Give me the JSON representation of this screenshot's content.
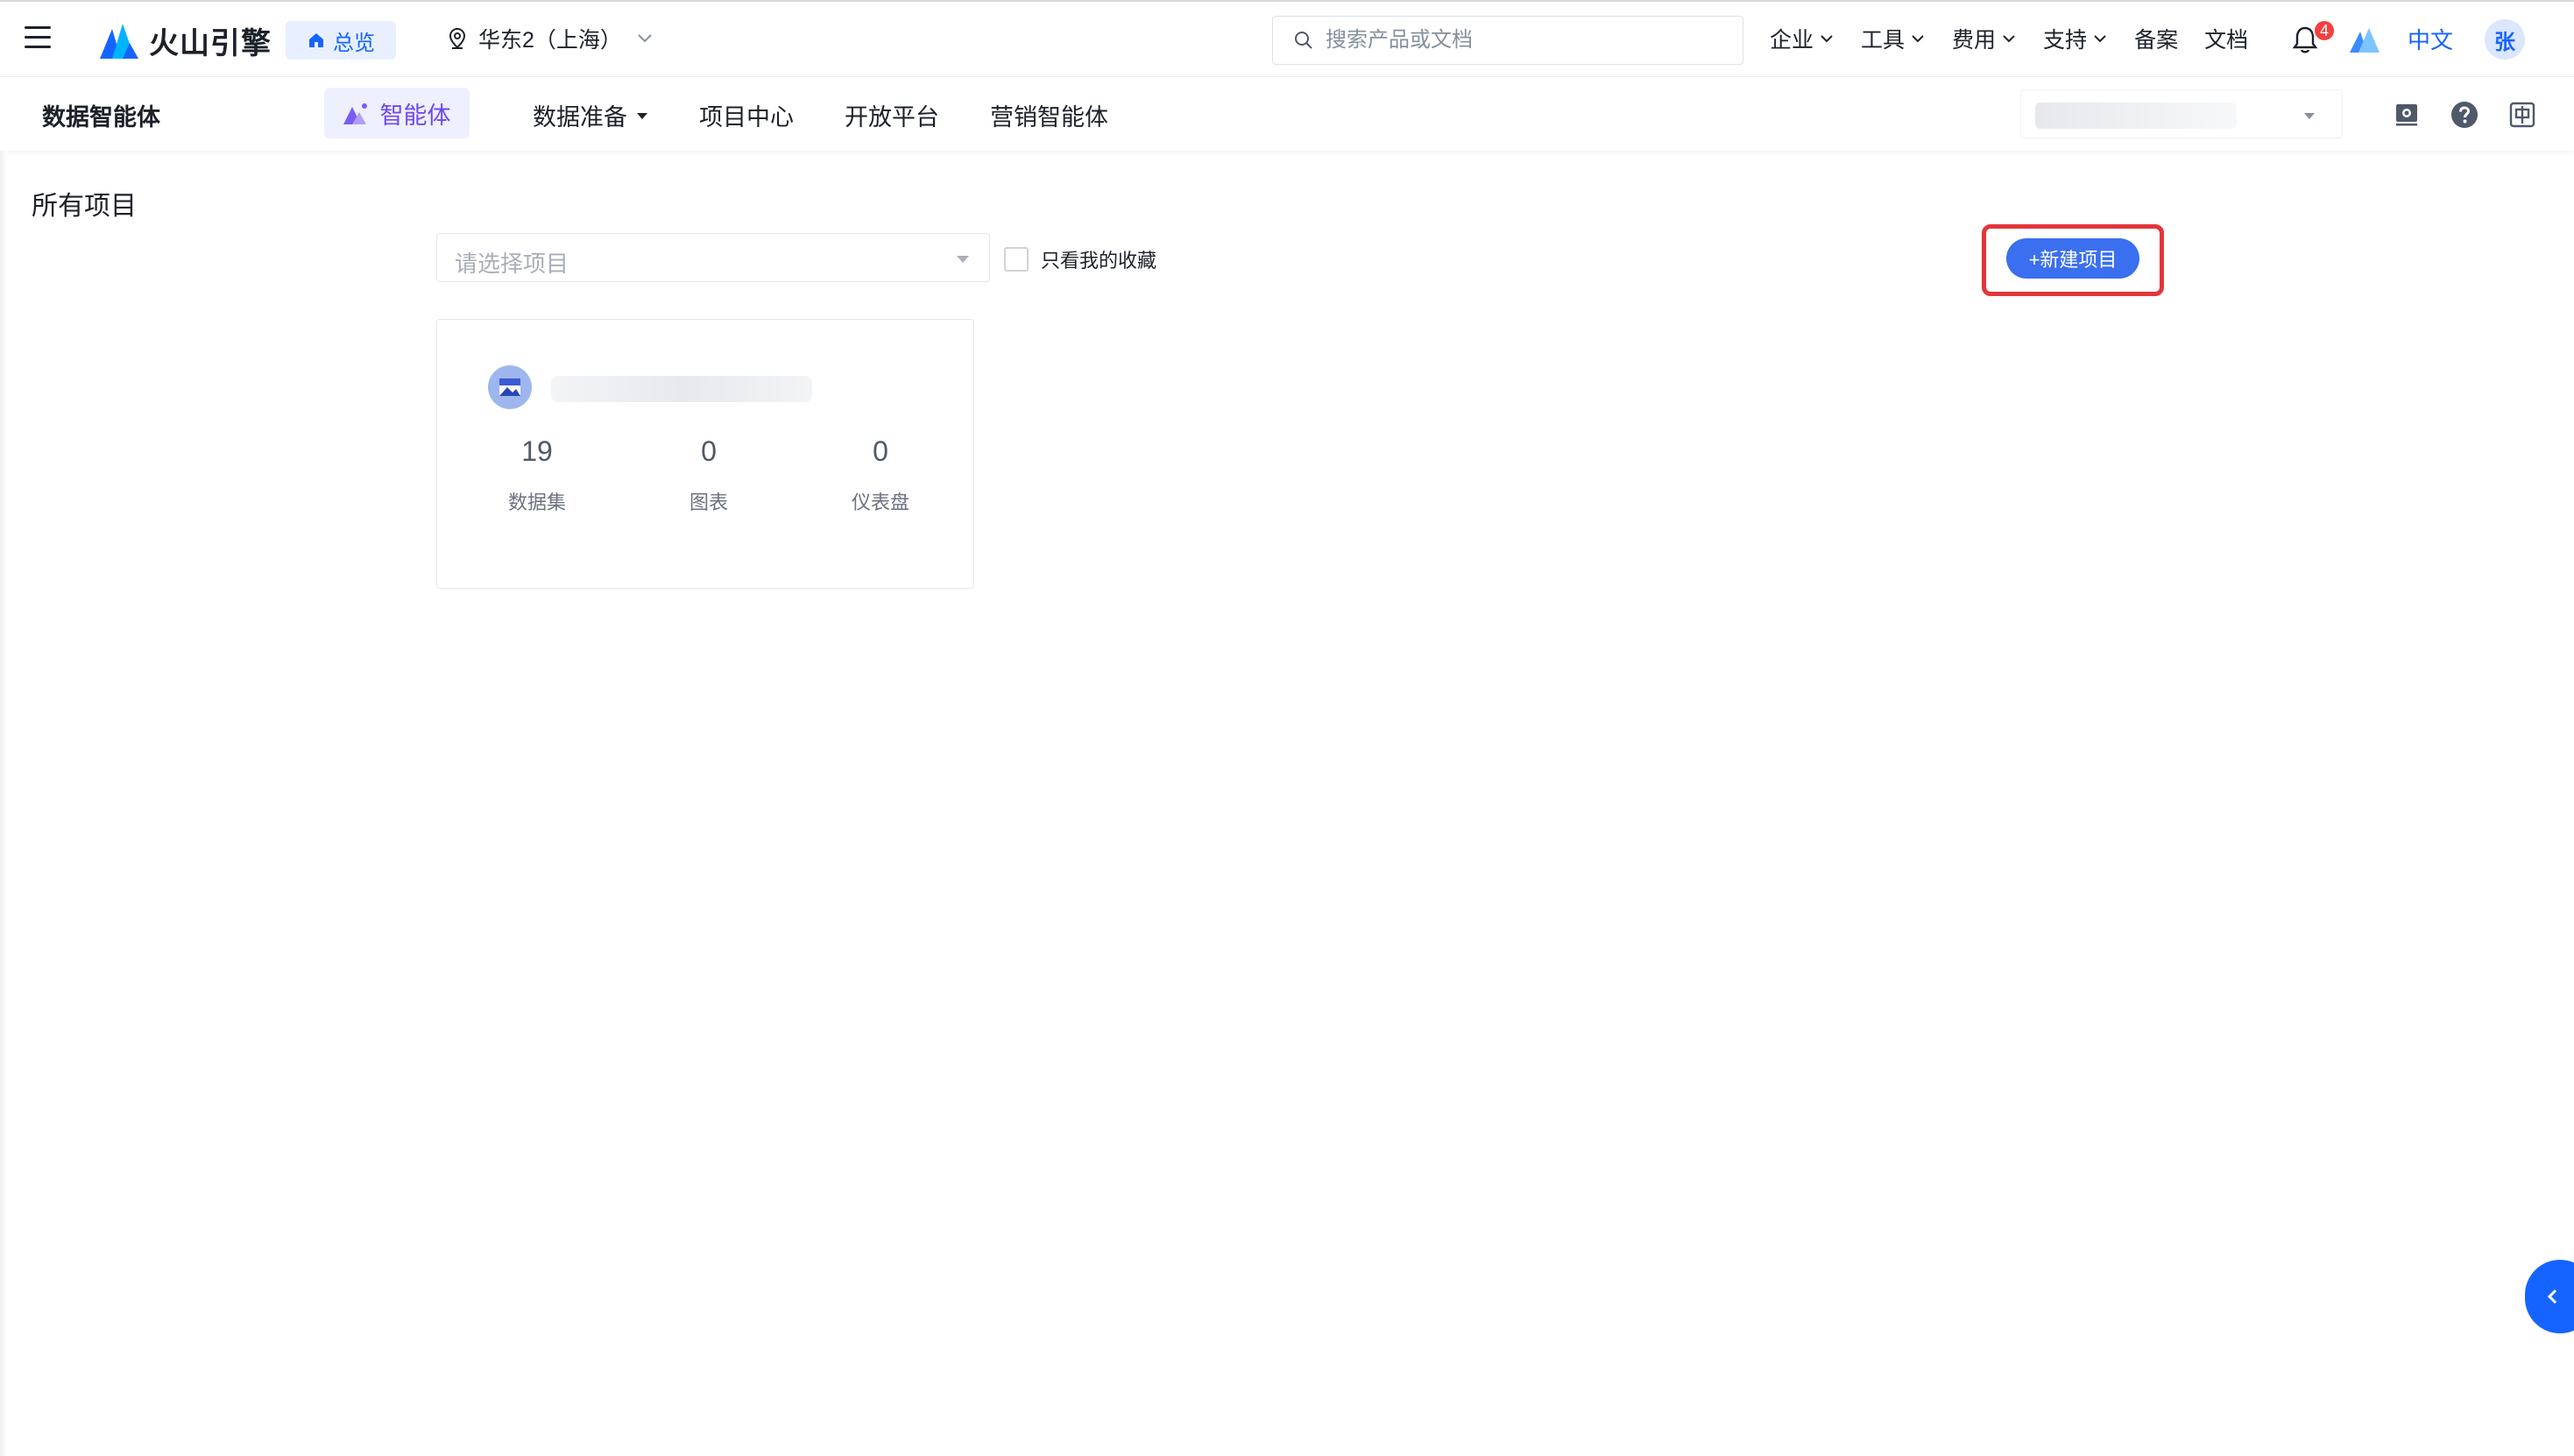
{
  "topbar": {
    "brand": "火山引擎",
    "overview": "总览",
    "region": "华东2（上海）",
    "search_placeholder": "搜索产品或文档",
    "menu": [
      "企业",
      "工具",
      "费用",
      "支持",
      "备案",
      "文档"
    ],
    "notification_count": "4",
    "language": "中文",
    "avatar": "张",
    "brand_color": "#1664ff"
  },
  "subnav": {
    "product": "数据智能体",
    "active_tab": "智能体",
    "tabs": [
      "数据准备",
      "项目中心",
      "开放平台",
      "营销智能体"
    ]
  },
  "content": {
    "title": "所有项目",
    "select_placeholder": "请选择项目",
    "fav_label": "只看我的收藏",
    "new_button": "+新建项目",
    "card": {
      "stats": [
        {
          "value": "19",
          "label": "数据集"
        },
        {
          "value": "0",
          "label": "图表"
        },
        {
          "value": "0",
          "label": "仪表盘"
        }
      ]
    },
    "highlight_color": "#e3353a"
  }
}
